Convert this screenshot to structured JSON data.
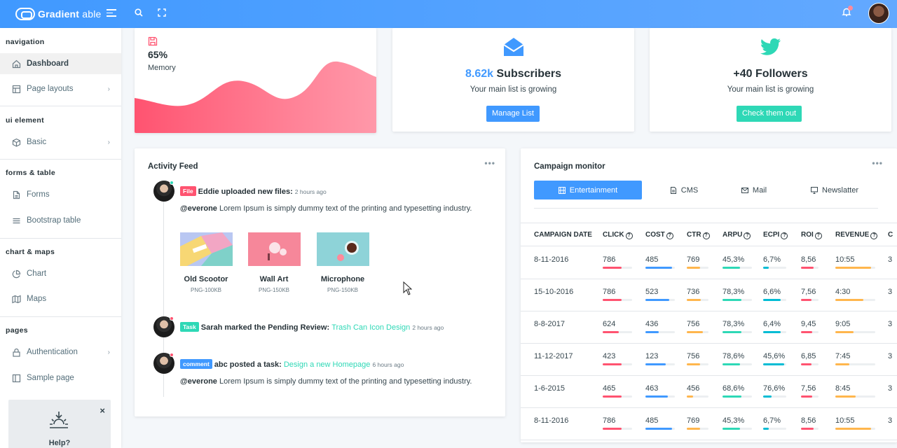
{
  "header": {
    "brand_bold": "Gradient",
    "brand_thin": " able"
  },
  "sidebar": {
    "groups": [
      {
        "label": "navigation",
        "items": [
          {
            "label": "Dashboard",
            "icon": "home-icon",
            "active": true
          },
          {
            "label": "Page layouts",
            "icon": "layout-icon",
            "chevron": true
          }
        ]
      },
      {
        "label": "ui element",
        "items": [
          {
            "label": "Basic",
            "icon": "box-icon",
            "chevron": true
          }
        ]
      },
      {
        "label": "forms & table",
        "items": [
          {
            "label": "Forms",
            "icon": "file-icon"
          },
          {
            "label": "Bootstrap table",
            "icon": "list-icon"
          }
        ]
      },
      {
        "label": "chart & maps",
        "items": [
          {
            "label": "Chart",
            "icon": "pie-chart-icon"
          },
          {
            "label": "Maps",
            "icon": "map-icon"
          }
        ]
      },
      {
        "label": "pages",
        "items": [
          {
            "label": "Authentication",
            "icon": "lock-icon",
            "chevron": true
          },
          {
            "label": "Sample page",
            "icon": "sidebar-icon"
          }
        ]
      }
    ],
    "help": {
      "label": "Help?",
      "close": "×"
    }
  },
  "memory_card": {
    "value": "65%",
    "label": "Memory",
    "accent": "#ff5370"
  },
  "subscribers_card": {
    "count": "8.62k",
    "label": "Subscribers",
    "subtitle": "Your main list is growing",
    "button": "Manage List",
    "color": "#4099ff"
  },
  "followers_card": {
    "title": "+40 Followers",
    "subtitle": "Your main list is growing",
    "button": "Check them out",
    "color": "#2ed8b6"
  },
  "activity_feed": {
    "title": "Activity Feed",
    "menu": "•••",
    "items": [
      {
        "badge": "File",
        "badge_color": "#ff5370",
        "text": "Eddie uploaded new files:",
        "time": "2 hours ago",
        "mention": "@everone",
        "body": " Lorem Ipsum is simply dummy text of the printing and typesetting industry.",
        "files": [
          {
            "name": "Old Scootor",
            "meta": "PNG-100KB"
          },
          {
            "name": "Wall Art",
            "meta": "PNG-150KB"
          },
          {
            "name": "Microphone",
            "meta": "PNG-150KB"
          }
        ],
        "status_color": "#2ed8b6"
      },
      {
        "badge": "Task",
        "badge_color": "#2ed8b6",
        "text": "Sarah marked the Pending Review: ",
        "link": "Trash Can Icon Design",
        "time": "2 hours ago",
        "status_color": "#ff5370"
      },
      {
        "badge": "comment",
        "badge_color": "#4099ff",
        "text": "abc posted a task: ",
        "link": "Design a new Homepage",
        "time": "6 hours ago",
        "mention": "@everone",
        "body": " Lorem Ipsum is simply dummy text of the printing and typesetting industry.",
        "status_color": "#ff5370"
      }
    ]
  },
  "campaign": {
    "title": "Campaign monitor",
    "menu": "•••",
    "tabs": [
      {
        "label": "Entertainment",
        "icon": "film-icon",
        "active": true
      },
      {
        "label": "CMS",
        "icon": "file-text-icon"
      },
      {
        "label": "Mail",
        "icon": "mail-icon"
      },
      {
        "label": "Newslatter",
        "icon": "monitor-icon"
      }
    ],
    "columns": [
      "CAMPAIGN DATE",
      "CLICK",
      "COST",
      "CTR",
      "ARPU",
      "ECPI",
      "ROI",
      "REVENUE",
      "C"
    ],
    "help_mark": "?",
    "bar_colors": [
      "#ff5370",
      "#4099ff",
      "#ffb64d",
      "#2ed8b6",
      "#00bcd4",
      "#ff5370",
      "#ffb64d",
      "#ffb64d"
    ],
    "rows": [
      {
        "date": "8-11-2016",
        "click": "786",
        "cost": "485",
        "ctr": "769",
        "arpu": "45,3%",
        "ecpi": "6,7%",
        "roi": "8,56",
        "revenue": "10:55",
        "more": "3",
        "levels": [
          0.65,
          0.9,
          0.6,
          0.6,
          0.25,
          0.7,
          0.9
        ]
      },
      {
        "date": "15-10-2016",
        "click": "786",
        "cost": "523",
        "ctr": "736",
        "arpu": "78,3%",
        "ecpi": "6,6%",
        "roi": "7,56",
        "revenue": "4:30",
        "more": "3",
        "levels": [
          0.65,
          0.8,
          0.65,
          0.65,
          0.75,
          0.6,
          0.7
        ]
      },
      {
        "date": "8-8-2017",
        "click": "624",
        "cost": "436",
        "ctr": "756",
        "arpu": "78,3%",
        "ecpi": "6,4%",
        "roi": "9,45",
        "revenue": "9:05",
        "more": "3",
        "levels": [
          0.55,
          0.45,
          0.75,
          0.65,
          0.75,
          0.65,
          0.45
        ]
      },
      {
        "date": "11-12-2017",
        "click": "423",
        "cost": "123",
        "ctr": "756",
        "arpu": "78,6%",
        "ecpi": "45,6%",
        "roi": "6,85",
        "revenue": "7:45",
        "more": "3",
        "levels": [
          0.65,
          0.7,
          0.6,
          0.6,
          0.9,
          0.6,
          0.35
        ]
      },
      {
        "date": "1-6-2015",
        "click": "465",
        "cost": "463",
        "ctr": "456",
        "arpu": "68,6%",
        "ecpi": "76,6%",
        "roi": "7,56",
        "revenue": "8:45",
        "more": "3",
        "levels": [
          0.65,
          0.75,
          0.3,
          0.65,
          0.35,
          0.65,
          0.5
        ]
      },
      {
        "date": "8-11-2016",
        "click": "786",
        "cost": "485",
        "ctr": "769",
        "arpu": "45,3%",
        "ecpi": "6,7%",
        "roi": "8,56",
        "revenue": "10:55",
        "more": "3",
        "levels": [
          0.65,
          0.9,
          0.6,
          0.6,
          0.25,
          0.7,
          0.9
        ]
      }
    ]
  }
}
